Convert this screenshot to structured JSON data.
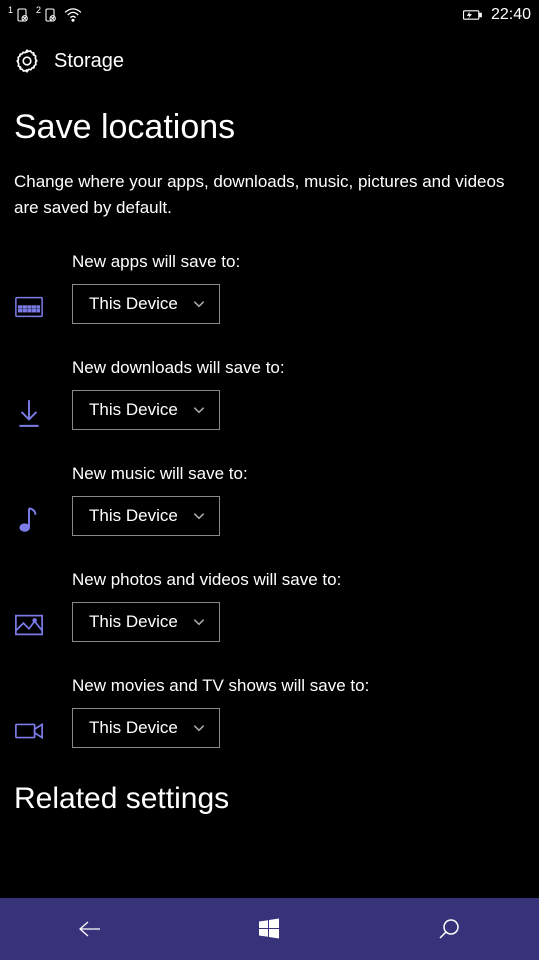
{
  "status": {
    "sim1": "1",
    "sim2": "2",
    "time": "22:40"
  },
  "header": {
    "title": "Storage"
  },
  "page": {
    "title": "Save locations",
    "subtitle": "Change where your apps, downloads, music, pictures and videos are saved by default."
  },
  "settings": [
    {
      "label": "New apps will save to:",
      "value": "This Device",
      "icon": "apps"
    },
    {
      "label": "New downloads will save to:",
      "value": "This Device",
      "icon": "download"
    },
    {
      "label": "New music will save to:",
      "value": "This Device",
      "icon": "music"
    },
    {
      "label": "New photos and videos will save to:",
      "value": "This Device",
      "icon": "photos"
    },
    {
      "label": "New movies and TV shows will save to:",
      "value": "This Device",
      "icon": "video"
    }
  ],
  "related": {
    "heading": "Related settings"
  }
}
